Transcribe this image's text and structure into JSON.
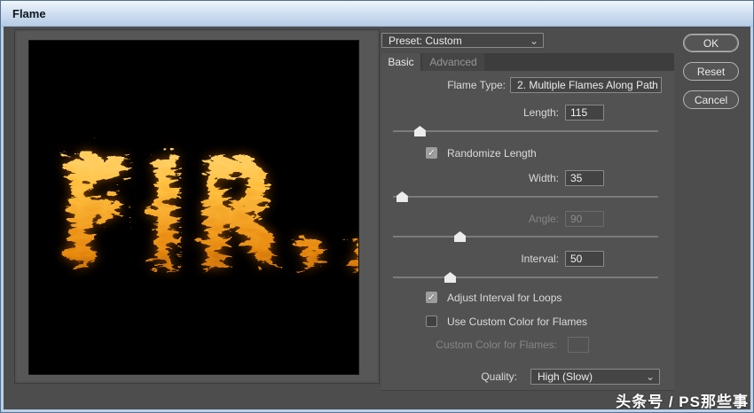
{
  "window": {
    "title": "Flame"
  },
  "preset": {
    "value": "Preset: Custom"
  },
  "tabs": {
    "basic": "Basic",
    "advanced": "Advanced"
  },
  "fields": {
    "flame_type": {
      "label": "Flame Type:",
      "value": "2. Multiple Flames Along Path"
    },
    "length": {
      "label": "Length:",
      "value": "115"
    },
    "randomize_length": {
      "label": "Randomize Length",
      "checked": true
    },
    "width": {
      "label": "Width:",
      "value": "35"
    },
    "angle": {
      "label": "Angle:",
      "value": "90",
      "disabled": true
    },
    "interval": {
      "label": "Interval:",
      "value": "50"
    },
    "adjust_interval_for_loops": {
      "label": "Adjust Interval for Loops",
      "checked": true
    },
    "use_custom_color": {
      "label": "Use Custom Color for Flames",
      "checked": false
    },
    "custom_color": {
      "label": "Custom Color for Flames:"
    },
    "quality": {
      "label": "Quality:",
      "value": "High (Slow)"
    }
  },
  "buttons": {
    "ok": "OK",
    "reset": "Reset",
    "cancel": "Cancel"
  },
  "preview": {
    "flame_text": "FIR..",
    "canvas_background": "#000000"
  },
  "watermark": "头条号 / PS那些事",
  "icons": {
    "chevron": "⌄",
    "check": "✓"
  },
  "colors": {
    "dialog_bg": "#4d4d4d",
    "panel_bg": "#525252",
    "titlebar": "#cdddef",
    "flame_core": "#ffe08a",
    "flame_mid": "#ffb627",
    "flame_deep": "#e07800",
    "flame_edge": "#9c4a00"
  }
}
